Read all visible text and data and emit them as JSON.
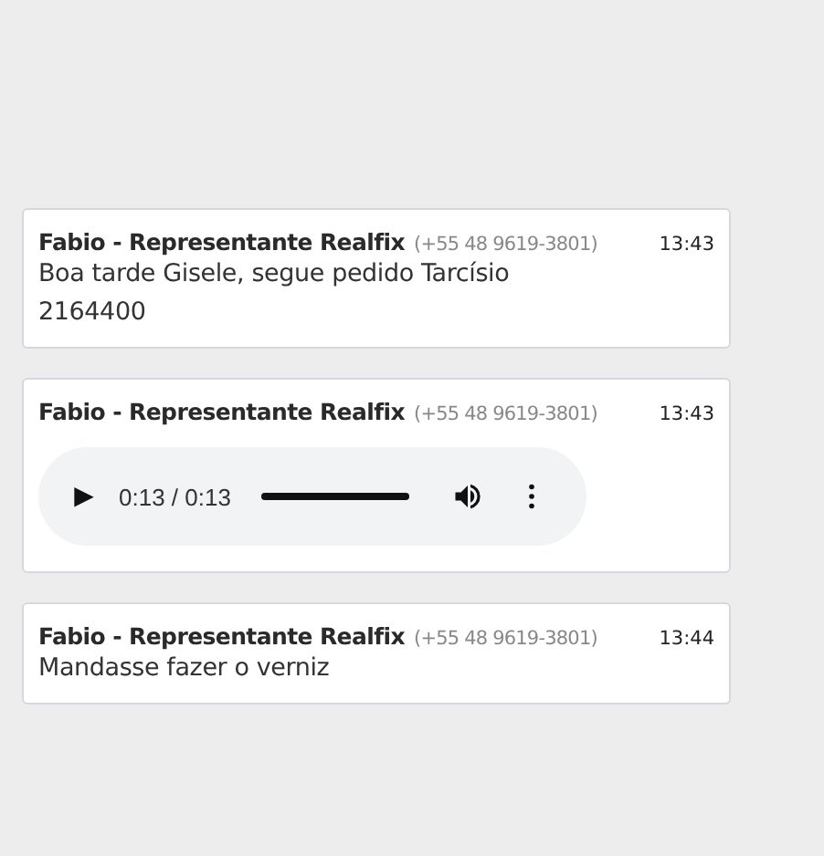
{
  "messages": [
    {
      "kind": "text",
      "sender": "Fabio - Representante Realfix",
      "phone": "(+55 48 9619-3801)",
      "time": "13:43",
      "lines": [
        "Boa tarde Gisele, segue pedido Tarcísio",
        "2164400"
      ]
    },
    {
      "kind": "audio",
      "sender": "Fabio - Representante Realfix",
      "phone": "(+55 48 9619-3801)",
      "time": "13:43",
      "audio": {
        "play_icon": "▶",
        "elapsed": "0:13 / 0:13",
        "level": 1
      }
    },
    {
      "kind": "text",
      "sender": "Fabio - Representante Realfix",
      "phone": "(+55 48 9619-3801)",
      "time": "13:44",
      "lines": [
        "Mandasse fazer o verniz"
      ]
    }
  ]
}
